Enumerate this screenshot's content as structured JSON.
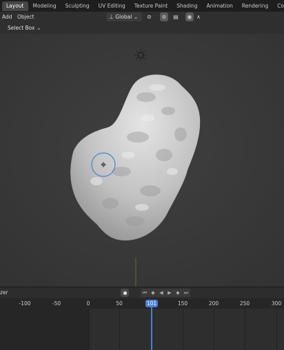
{
  "workspace_tabs": [
    "Layout",
    "Modeling",
    "Sculpting",
    "UV Editing",
    "Texture Paint",
    "Shading",
    "Animation",
    "Rendering",
    "Composit"
  ],
  "active_tab": "Layout",
  "header": {
    "menus": [
      "Add",
      "Object"
    ],
    "transform_orientation": "Global",
    "select_mode": "Select Box"
  },
  "timeline": {
    "left_label": "zer",
    "current_frame": "101",
    "ruler_ticks": [
      "-100",
      "-50",
      "0",
      "50",
      "100",
      "150",
      "200",
      "250",
      "300"
    ]
  },
  "colors": {
    "accent": "#4a7fd6",
    "viewport_bg": "#3a3a3a",
    "mesh": "#c8c8c8"
  }
}
